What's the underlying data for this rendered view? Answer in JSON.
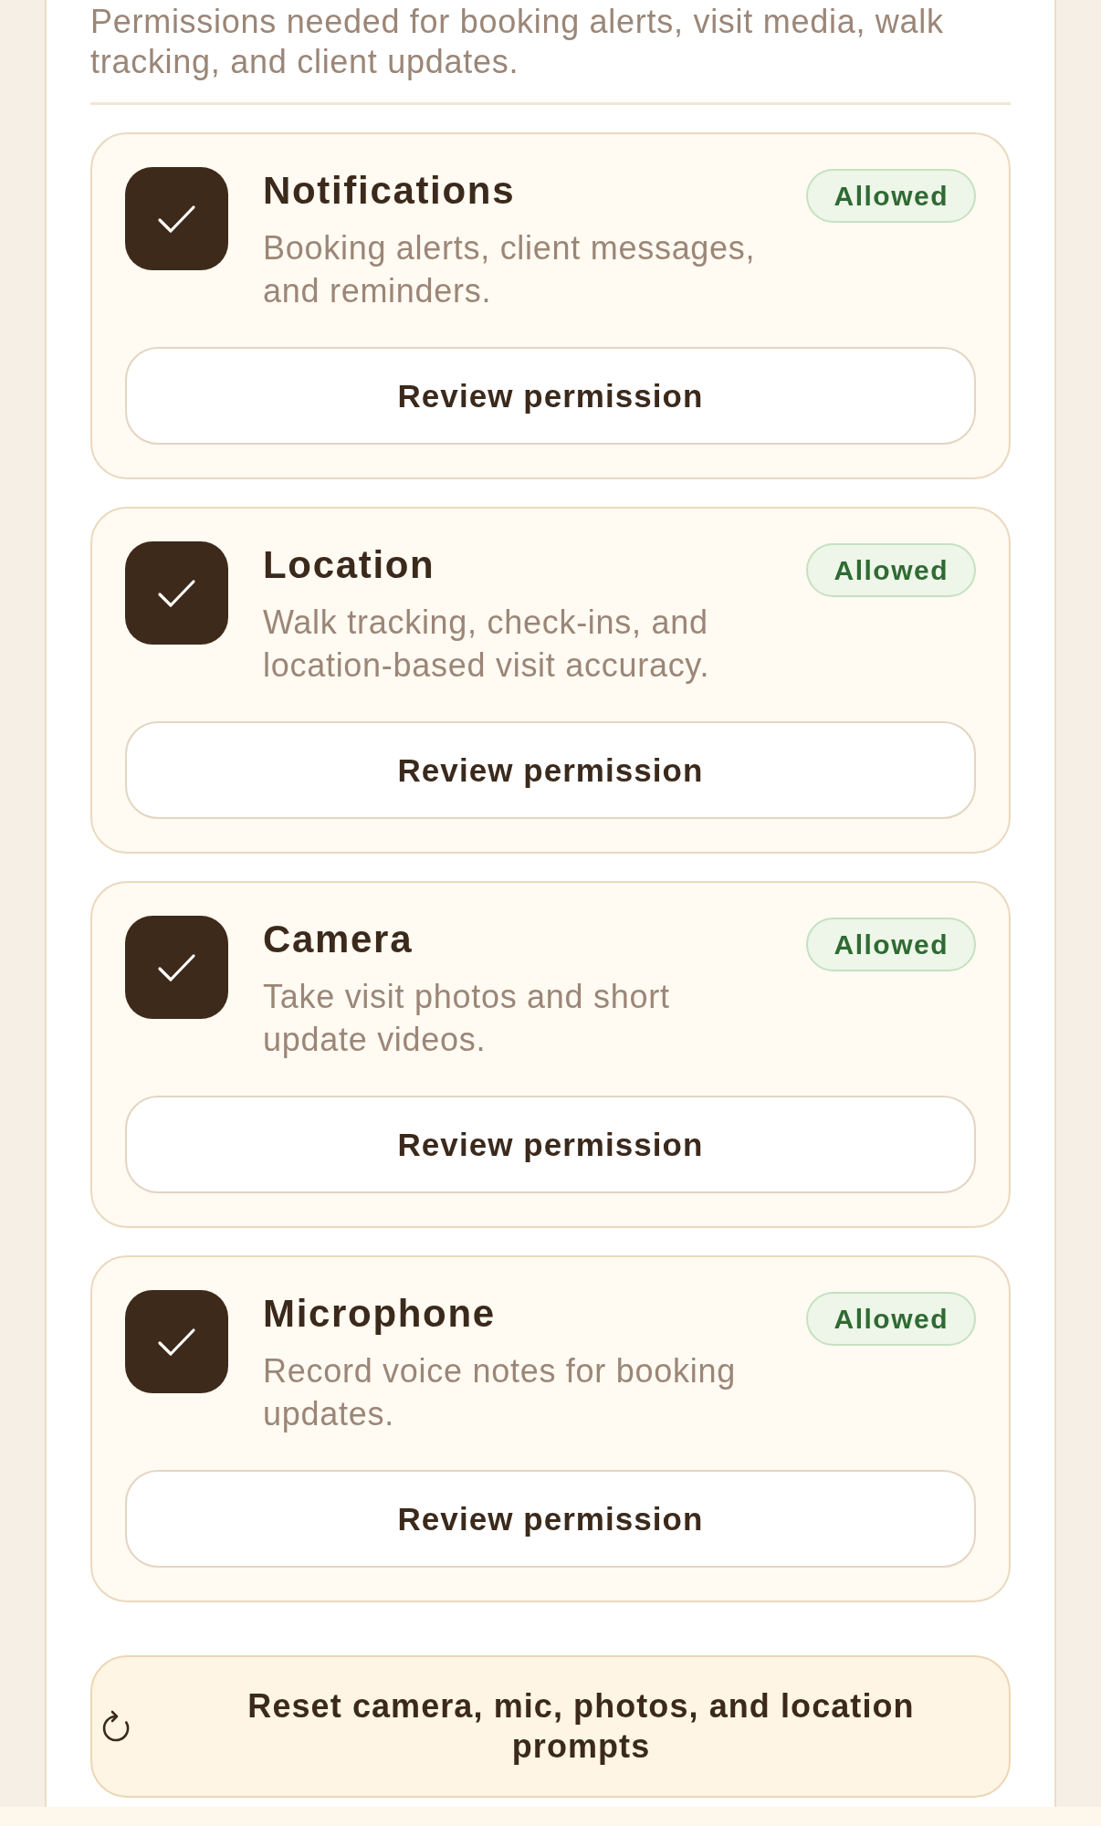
{
  "intro": {
    "text": "Permissions needed for booking alerts, visit media, walk tracking, and client updates."
  },
  "permissions": [
    {
      "title": "Notifications",
      "description": "Booking alerts, client messages, and reminders.",
      "checked": true,
      "status": "Allowed",
      "action": "Review permission"
    },
    {
      "title": "Location",
      "description": "Walk tracking, check-ins, and location-based visit accuracy.",
      "checked": true,
      "status": "Allowed",
      "action": "Review permission"
    },
    {
      "title": "Camera",
      "description": "Take visit photos and short update videos.",
      "checked": true,
      "status": "Allowed",
      "action": "Review permission"
    },
    {
      "title": "Microphone",
      "description": "Record voice notes for booking updates.",
      "checked": true,
      "status": "Allowed",
      "action": "Review permission"
    }
  ],
  "reset_button": {
    "label": "Reset camera, mic, photos, and location prompts"
  }
}
